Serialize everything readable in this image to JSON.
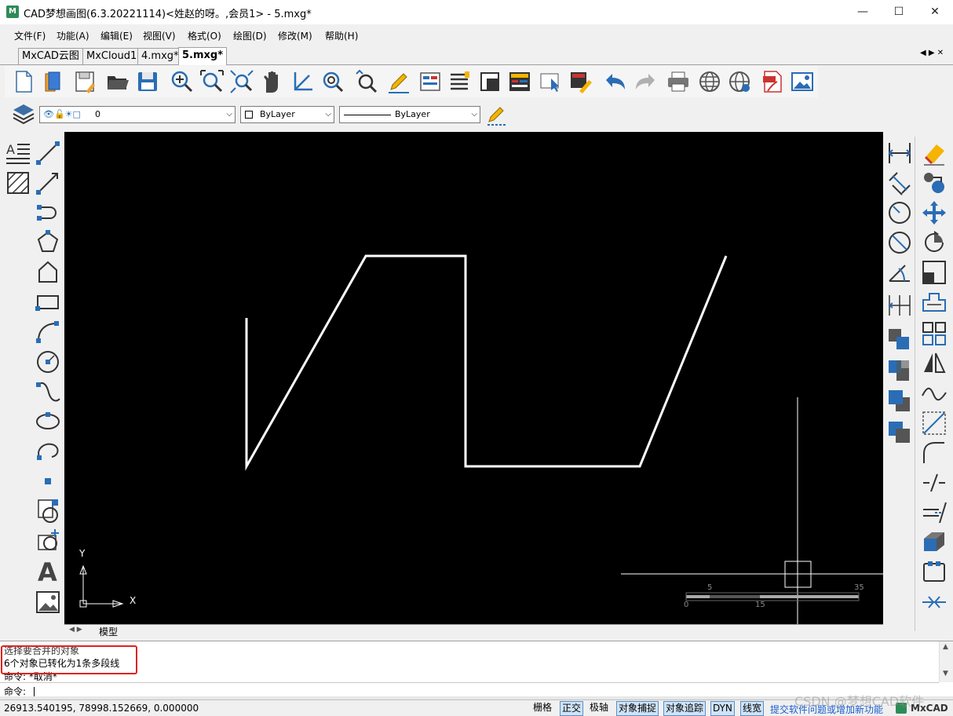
{
  "window": {
    "title": "CAD梦想画图(6.3.20221114)<姓赵的呀。,会员1> - 5.mxg*",
    "app_icon_label": "M",
    "minimize": "—",
    "maximize": "☐",
    "close": "✕"
  },
  "menu": [
    "文件(F)",
    "功能(A)",
    "编辑(E)",
    "视图(V)",
    "格式(O)",
    "绘图(D)",
    "修改(M)",
    "帮助(H)"
  ],
  "tabs": [
    {
      "label": "MxCAD云图",
      "active": false
    },
    {
      "label": "MxCloud1",
      "active": false
    },
    {
      "label": "4.mxg*",
      "active": false
    },
    {
      "label": "5.mxg*",
      "active": true
    }
  ],
  "tab_nav": "◀ ▶ ✕",
  "layer_combo": {
    "value": "0"
  },
  "color_combo": {
    "value": "ByLayer"
  },
  "linetype_combo": {
    "value": "ByLayer"
  },
  "canvas": {
    "ucs_x_label": "X",
    "ucs_y_label": "Y",
    "scale_top_labels": [
      "5",
      "35"
    ],
    "scale_bottom_labels": [
      "0",
      "15"
    ]
  },
  "model_tab": {
    "label": "模型",
    "nav": "◀ ▶"
  },
  "command": {
    "lines": [
      "选择要合并的对象",
      "6个对象已转化为1条多段线",
      "命令:  *取消*"
    ],
    "prompt": "命令:"
  },
  "status": {
    "coords": "26913.540195,  78998.152669,  0.000000",
    "buttons": [
      {
        "label": "栅格",
        "on": false
      },
      {
        "label": "正交",
        "on": true
      },
      {
        "label": "极轴",
        "on": false
      },
      {
        "label": "对象捕捉",
        "on": true
      },
      {
        "label": "对象追踪",
        "on": true
      },
      {
        "label": "DYN",
        "on": true
      },
      {
        "label": "线宽",
        "on": true
      }
    ],
    "feedback_link": "提交软件问题或增加新功能",
    "brand": "MxCAD"
  },
  "watermark": "CSDN @梦想CAD软件"
}
